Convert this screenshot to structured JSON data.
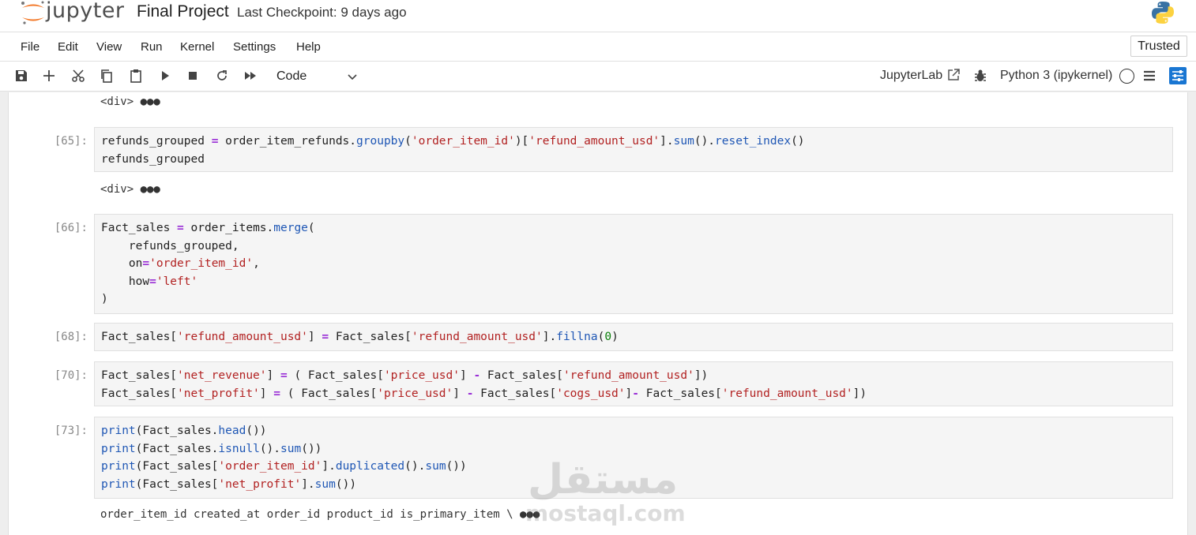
{
  "header": {
    "logo_text": "jupyter",
    "notebook_title": "Final Project",
    "checkpoint": "Last Checkpoint: 9 days ago"
  },
  "menu": {
    "items": [
      "File",
      "Edit",
      "View",
      "Run",
      "Kernel",
      "Settings",
      "Help"
    ],
    "trusted": "Trusted"
  },
  "toolbar": {
    "cell_type": "Code",
    "jupyterlab": "JupyterLab",
    "kernel": "Python 3 (ipykernel)",
    "accent": "#1976d2"
  },
  "cells": {
    "out_top": "<div> ●●●",
    "c65": {
      "prompt": "[65]:",
      "output": "<div> ●●●"
    },
    "c66": {
      "prompt": "[66]:"
    },
    "c68": {
      "prompt": "[68]:"
    },
    "c70": {
      "prompt": "[70]:"
    },
    "c73": {
      "prompt": "[73]:",
      "output": "order_item_id created_at order_id product_id is_primary_item \\ ●●●"
    }
  },
  "code": {
    "c65_l1": [
      "refunds_grouped ",
      "=",
      " order_item_refunds.",
      "groupby",
      "(",
      "'order_item_id'",
      ")[",
      "'refund_amount_usd'",
      "].",
      "sum",
      "().",
      "reset_index",
      "()"
    ],
    "c65_l2": "refunds_grouped",
    "c66_l1": [
      "Fact_sales ",
      "=",
      " order_items.",
      "merge",
      "("
    ],
    "c66_l2": "    refunds_grouped,",
    "c66_l3": [
      "    on",
      "=",
      "'order_item_id'",
      ","
    ],
    "c66_l4": [
      "    how",
      "=",
      "'left'"
    ],
    "c66_l5": ")",
    "c68_l1": [
      "Fact_sales[",
      "'refund_amount_usd'",
      "] ",
      "=",
      " Fact_sales[",
      "'refund_amount_usd'",
      "].",
      "fillna",
      "(",
      "0",
      ")"
    ],
    "c70_l1": [
      "Fact_sales[",
      "'net_revenue'",
      "] ",
      "=",
      " ( Fact_sales[",
      "'price_usd'",
      "] ",
      "-",
      " Fact_sales[",
      "'refund_amount_usd'",
      "])"
    ],
    "c70_l2": [
      "Fact_sales[",
      "'net_profit'",
      "] ",
      "=",
      " ( Fact_sales[",
      "'price_usd'",
      "] ",
      "-",
      " Fact_sales[",
      "'cogs_usd'",
      "]",
      "-",
      " Fact_sales[",
      "'refund_amount_usd'",
      "])"
    ],
    "c73_l1": [
      "print",
      "(Fact_sales.",
      "head",
      "())"
    ],
    "c73_l2": [
      "print",
      "(Fact_sales.",
      "isnull",
      "().",
      "sum",
      "())"
    ],
    "c73_l3": [
      "print",
      "(Fact_sales[",
      "'order_item_id'",
      "].",
      "duplicated",
      "().",
      "sum",
      "())"
    ],
    "c73_l4": [
      "print",
      "(Fact_sales[",
      "'net_profit'",
      "].",
      "sum",
      "())"
    ]
  },
  "watermark": {
    "arabic": "مستقل",
    "url": "mostaql.com"
  }
}
